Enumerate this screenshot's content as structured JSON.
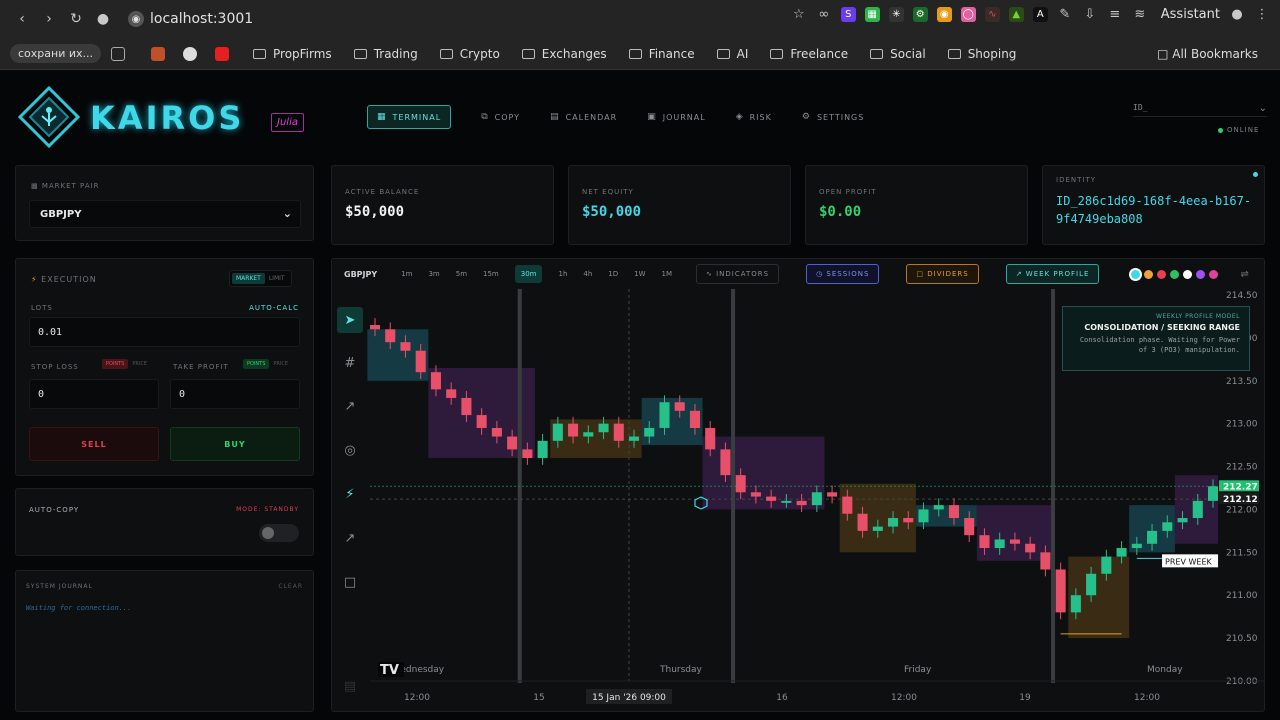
{
  "browser": {
    "url": "localhost:3001",
    "assistant": "Assistant",
    "bookmarks": [
      "сохрани их...",
      "PropFirms",
      "Trading",
      "Crypto",
      "Exchanges",
      "Finance",
      "AI",
      "Freelance",
      "Social",
      "Shoping"
    ],
    "all_bookmarks": "All Bookmarks"
  },
  "app": {
    "logo": "KAIROS",
    "badge": "Julia",
    "nav": [
      "TERMINAL",
      "COPY",
      "CALENDAR",
      "JOURNAL",
      "RISK",
      "SETTINGS"
    ],
    "id_select": "ID_",
    "online": "ONLINE"
  },
  "stats": {
    "market_pair_label": "MARKET PAIR",
    "market_pair": "GBPJPY",
    "active_balance_label": "ACTIVE BALANCE",
    "active_balance": "$50,000",
    "net_equity_label": "NET EQUITY",
    "net_equity": "$50,000",
    "open_profit_label": "OPEN PROFIT",
    "open_profit": "$0.00",
    "identity_label": "IDENTITY",
    "identity": "ID_286c1d69-168f-4eea-b167-9f4749eba808"
  },
  "execution": {
    "title": "EXECUTION",
    "mode_market": "MARKET",
    "mode_limit": "LIMIT",
    "lots_label": "LOTS",
    "auto_calc": "AUTO-CALC",
    "lots": "0.01",
    "stop_loss_label": "STOP LOSS",
    "take_profit_label": "TAKE PROFIT",
    "points": "POINTS",
    "price": "PRICE",
    "stop_loss": "0",
    "take_profit": "0",
    "sell": "SELL",
    "buy": "BUY"
  },
  "autocopy": {
    "title": "AUTO-COPY",
    "mode": "MODE: STANDBY"
  },
  "journal": {
    "title": "SYSTEM JOURNAL",
    "clear": "CLEAR",
    "status": "Waiting for connection..."
  },
  "chart_toolbar": {
    "symbol": "GBPJPY",
    "timeframes": [
      "1m",
      "3m",
      "5m",
      "15m",
      "30m",
      "1h",
      "4h",
      "1D",
      "1W",
      "1M"
    ],
    "active_tf": "30m",
    "indicators": "INDICATORS",
    "sessions": "SESSIONS",
    "dividers": "DIVIDERS",
    "week_profile": "WEEK PROFILE",
    "swatches": [
      "#3fd8e8",
      "#f0a040",
      "#e84050",
      "#30c060",
      "#ffffff",
      "#a050f0",
      "#e040a0"
    ]
  },
  "tooltip": {
    "kicker": "WEEKLY PROFILE MODEL",
    "title": "CONSOLIDATION / SEEKING RANGE",
    "body": "Consolidation phase. Waiting for Power of 3 (PO3) manipulation."
  },
  "chart_data": {
    "type": "candlestick",
    "symbol": "GBPJPY",
    "y_ticks": [
      "214.50",
      "214.00",
      "213.50",
      "213.00",
      "212.50",
      "212.00",
      "211.50",
      "211.00",
      "210.50",
      "210.00"
    ],
    "ylim": [
      210.0,
      214.5
    ],
    "day_labels": [
      "Wednesday",
      "Thursday",
      "Friday",
      "Monday"
    ],
    "x_ticks": [
      "12:00",
      "15",
      "16",
      "12:00",
      "19",
      "12:00"
    ],
    "crosshair_time": "15 Jan '26  09:00",
    "last_price": "212.27",
    "cursor_price": "212.12",
    "prev_week_label": "PREV WEEK",
    "prev_week_level": 211.43,
    "close_path": [
      214.1,
      213.95,
      213.85,
      213.6,
      213.4,
      213.3,
      213.1,
      212.95,
      212.85,
      212.7,
      212.6,
      212.8,
      213.0,
      212.85,
      212.9,
      213.0,
      212.8,
      212.85,
      212.95,
      213.25,
      213.15,
      212.95,
      212.7,
      212.4,
      212.2,
      212.15,
      212.1,
      212.1,
      212.05,
      212.2,
      212.15,
      211.95,
      211.75,
      211.8,
      211.9,
      211.85,
      212.0,
      212.05,
      211.9,
      211.7,
      211.55,
      211.65,
      211.6,
      211.5,
      211.3,
      210.8,
      211.0,
      211.25,
      211.45,
      211.55,
      211.6,
      211.75,
      211.85,
      211.9,
      212.1,
      212.27
    ],
    "session_boxes": [
      {
        "from": 0,
        "to": 3,
        "low": 213.5,
        "high": 214.1,
        "color": "#1a4a55"
      },
      {
        "from": 4,
        "to": 10,
        "low": 212.6,
        "high": 213.65,
        "color": "#3a1f4a"
      },
      {
        "from": 12,
        "to": 17,
        "low": 212.6,
        "high": 213.05,
        "color": "#4a3516"
      },
      {
        "from": 18,
        "to": 21,
        "low": 212.75,
        "high": 213.3,
        "color": "#1a4a55"
      },
      {
        "from": 22,
        "to": 29,
        "low": 212.0,
        "high": 212.85,
        "color": "#3a1f4a"
      },
      {
        "from": 31,
        "to": 35,
        "low": 211.5,
        "high": 212.3,
        "color": "#4a3516"
      },
      {
        "from": 36,
        "to": 39,
        "low": 211.8,
        "high": 212.05,
        "color": "#1a4a55"
      },
      {
        "from": 40,
        "to": 44,
        "low": 211.4,
        "high": 212.05,
        "color": "#3a1f4a"
      },
      {
        "from": 46,
        "to": 49,
        "low": 210.5,
        "high": 211.45,
        "color": "#4a3516"
      },
      {
        "from": 50,
        "to": 52,
        "low": 211.5,
        "high": 212.05,
        "color": "#1a4a55"
      },
      {
        "from": 53,
        "to": 55,
        "low": 211.6,
        "high": 212.4,
        "color": "#3a1f4a"
      }
    ]
  }
}
